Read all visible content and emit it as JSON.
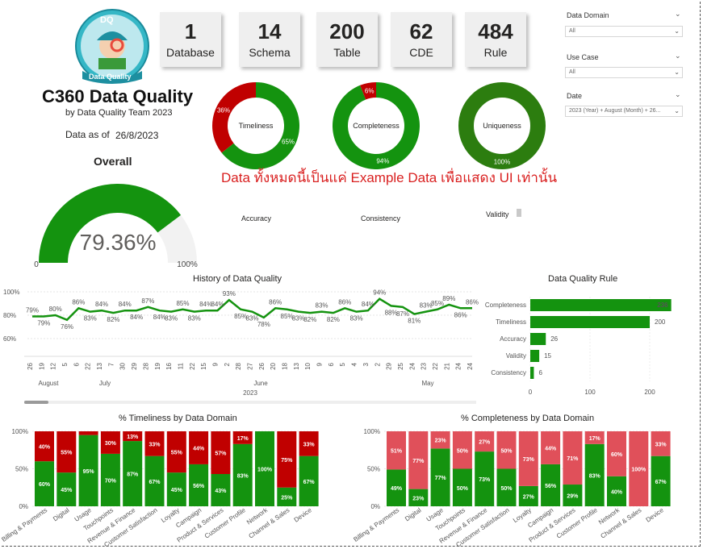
{
  "colors": {
    "green": "#14930f",
    "red": "#c00000",
    "pink": "#e0505a",
    "gauge_bg": "#f2f2f2",
    "dark_green": "#2c7d0f"
  },
  "logo": {
    "badge": "DQ",
    "caption": "Data Quality"
  },
  "cards": [
    {
      "value": "1",
      "label": "Database"
    },
    {
      "value": "14",
      "label": "Schema"
    },
    {
      "value": "200",
      "label": "Table"
    },
    {
      "value": "62",
      "label": "CDE"
    },
    {
      "value": "484",
      "label": "Rule"
    }
  ],
  "slicers": [
    {
      "label": "Data Domain",
      "value": "All"
    },
    {
      "label": "Use Case",
      "value": "All"
    },
    {
      "label": "Date",
      "value": "2023 (Year) + August (Month) + 26..."
    }
  ],
  "header": {
    "title": "C360 Data Quality",
    "byline": "by Data Quality Team 2023",
    "data_as_of_label": "Data as of",
    "data_as_of_value": "26/8/2023",
    "overall_label": "Overall"
  },
  "gauge": {
    "value": 79.36,
    "display": "79.36%",
    "min_label": "0",
    "max_label": "100%"
  },
  "donuts": [
    {
      "name": "Timeliness",
      "good": 65,
      "bad": 36,
      "good_label": "65%",
      "bad_label": "36%"
    },
    {
      "name": "Completeness",
      "good": 94,
      "bad": 6,
      "good_label": "94%",
      "bad_label": "6%"
    },
    {
      "name": "Uniqueness",
      "good": 100,
      "bad": 0,
      "good_label": "100%",
      "bad_label": ""
    }
  ],
  "notice": "Data ทั้งหมดนี้เป็นแค่ Example Data เพื่อแสดง UI เท่านั้น",
  "other_dims": {
    "accuracy": "Accuracy",
    "consistency": "Consistency",
    "validity": "Validity"
  },
  "chart_data": [
    {
      "type": "line",
      "title": "History of Data Quality",
      "y_ticks": [
        "100%",
        "80%",
        "60%"
      ],
      "ylim": [
        60,
        100
      ],
      "values": [
        79,
        79,
        80,
        76,
        86,
        83,
        84,
        82,
        84,
        84,
        87,
        84,
        83,
        85,
        83,
        84,
        84,
        93,
        85,
        83,
        78,
        86,
        85,
        83,
        82,
        83,
        82,
        86,
        83,
        84,
        94,
        88,
        87,
        81,
        83,
        85,
        89,
        86,
        86
      ],
      "labels": [
        "79%",
        "79%",
        "80%",
        "76%",
        "86%",
        "83%",
        "84%",
        "82%",
        "84%",
        "84%",
        "87%",
        "84%",
        "83%",
        "85%",
        "83%",
        "84%",
        "84%",
        "93%",
        "85%",
        "83%",
        "78%",
        "86%",
        "85%",
        "83%",
        "82%",
        "83%",
        "82%",
        "86%",
        "83%",
        "84%",
        "94%",
        "88%",
        "87%",
        "81%",
        "83%",
        "85%",
        "89%",
        "86%",
        "86%"
      ],
      "day_ticks": [
        "26",
        "19",
        "12",
        "5",
        "6",
        "22",
        "13",
        "7",
        "30",
        "29",
        "28",
        "19",
        "16",
        "11",
        "22",
        "15",
        "9",
        "2",
        "28",
        "27",
        "26",
        "20",
        "18",
        "13",
        "10",
        "9",
        "6",
        "5",
        "4",
        "3",
        "2",
        "29",
        "25",
        "24",
        "23",
        "22",
        "21",
        "24",
        "24"
      ],
      "months": [
        "August",
        "July",
        "June",
        "May"
      ],
      "year": "2023"
    },
    {
      "type": "bar",
      "orientation": "horizontal",
      "title": "Data Quality Rule",
      "categories": [
        "Completeness",
        "Timeliness",
        "Accuracy",
        "Validity",
        "Consistency"
      ],
      "values": [
        236,
        200,
        26,
        15,
        6
      ],
      "x_ticks": [
        "0",
        "100",
        "200"
      ],
      "xlim": [
        0,
        250
      ]
    },
    {
      "type": "bar",
      "stacked": true,
      "title": "% Timeliness by Data Domain",
      "categories": [
        "Billing & Payments",
        "Digital",
        "Usage",
        "Touchpoints",
        "Revenue & Finance",
        "Customer Satisfaction",
        "Loyalty",
        "Campaign",
        "Product & Services",
        "Customer Profile",
        "Network",
        "Channel & Sales",
        "Device"
      ],
      "series": [
        {
          "values": [
            60,
            45,
            95,
            70,
            87,
            67,
            45,
            56,
            43,
            83,
            100,
            25,
            67
          ],
          "labels": [
            "60%",
            "45%",
            "95%",
            "70%",
            "87%",
            "67%",
            "45%",
            "56%",
            "43%",
            "83%",
            "100%",
            "25%",
            "67%"
          ]
        },
        {
          "values": [
            40,
            55,
            5,
            30,
            13,
            33,
            55,
            44,
            57,
            17,
            0,
            75,
            33
          ],
          "labels": [
            "40%",
            "55%",
            "",
            "30%",
            "13%",
            "33%",
            "55%",
            "44%",
            "57%",
            "17%",
            "",
            "75%",
            "33%"
          ]
        }
      ],
      "y_ticks": [
        "100%",
        "50%",
        "0%"
      ],
      "ylim": [
        0,
        100
      ]
    },
    {
      "type": "bar",
      "stacked": true,
      "title": "% Completeness by Data Domain",
      "categories": [
        "Billing & Payments",
        "Digital",
        "Usage",
        "Touchpoints",
        "Revenue & Finance",
        "Customer Satisfaction",
        "Loyalty",
        "Campaign",
        "Product & Services",
        "Customer Profile",
        "Network",
        "Channel & Sales",
        "Device"
      ],
      "series": [
        {
          "values": [
            49,
            23,
            77,
            50,
            73,
            50,
            27,
            56,
            29,
            83,
            40,
            0,
            67
          ],
          "labels": [
            "49%",
            "23%",
            "77%",
            "50%",
            "73%",
            "50%",
            "27%",
            "56%",
            "29%",
            "83%",
            "40%",
            "",
            "67%"
          ]
        },
        {
          "values": [
            51,
            77,
            23,
            50,
            27,
            50,
            73,
            44,
            71,
            17,
            60,
            100,
            33
          ],
          "labels": [
            "51%",
            "77%",
            "23%",
            "50%",
            "27%",
            "50%",
            "73%",
            "44%",
            "71%",
            "17%",
            "60%",
            "100%",
            "33%"
          ]
        }
      ],
      "y_ticks": [
        "100%",
        "50%",
        "0%"
      ],
      "ylim": [
        0,
        100
      ]
    }
  ]
}
